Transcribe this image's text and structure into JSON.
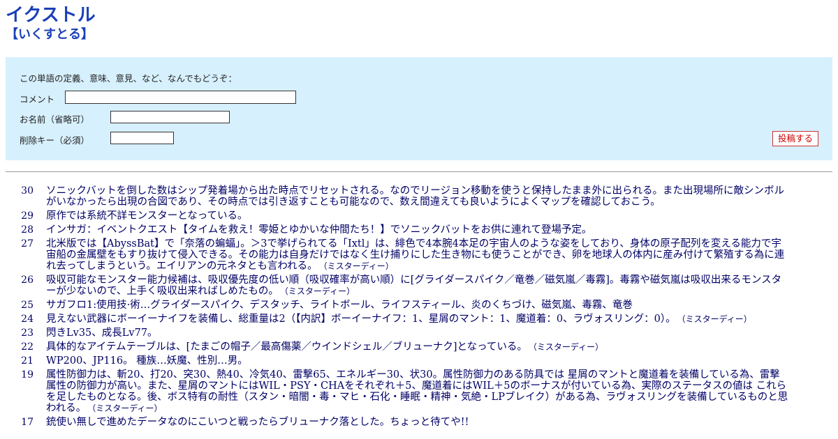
{
  "header": {
    "title": "イクストル",
    "reading": "【いくすとる】"
  },
  "form": {
    "prompt": "この単語の定義、意味、意見、など、なんでもどうぞ：",
    "comment_label": "コメント",
    "name_label": "お名前（省略可）",
    "delete_key_label": "削除キー（必須）",
    "submit_label": "投稿する",
    "comment_value": "",
    "name_value": "",
    "delete_key_value": ""
  },
  "entries": [
    {
      "num": "30",
      "text": "ソニックバットを倒した数はシップ発着場から出た時点でリセットされる。なのでリージョン移動を使うと保持したまま外に出られる。また出現場所に敵シンボルがいなかったら出現の合図であり、その時点では引き返すことも可能なので、数え間違えても良いようによくマップを確認しておこう。",
      "author": ""
    },
    {
      "num": "29",
      "text": "原作では系統不詳モンスターとなっている。",
      "author": ""
    },
    {
      "num": "28",
      "text": "インサガ：イベントクエスト【タイムを救え！零姫とゆかいな仲間たち！】でソニックバットをお供に連れて登場予定。",
      "author": ""
    },
    {
      "num": "27",
      "text": "北米版では【AbyssBat】で「奈落の蝙蝠」。＞3で挙げられてる「Ixtl」は、緋色で4本腕4本足の宇宙人のような姿をしており、身体の原子配列を変える能力で宇宙船の金属壁をもすり抜けて侵入できる。その能力は自身だけではなく生け捕りにした生き物にも使うことができ、卵を地球人の体内に産み付けて繁殖する為に連れ去ってしまうという。エイリアンの元ネタとも言われる。",
      "author": "（ミスターディー）"
    },
    {
      "num": "26",
      "text": "吸収可能なモンスター能力候補は、吸収優先度の低い順（吸収確率が高い順）に[グライダースパイク／竜巻／磁気嵐／毒霧]。毒霧や磁気嵐は吸収出来るモンスターが少ないので、上手く吸収出来ればしめたもの。",
      "author": "（ミスターディー）"
    },
    {
      "num": "25",
      "text": "サガフロ1:使用技·術…グライダースパイク、デスタッチ、ライトボール、ライフスティール、炎のくちづけ、磁気嵐、毒霧、竜巻",
      "author": ""
    },
    {
      "num": "24",
      "text": "見えない武器にボーイーナイフを装備し、総重量は2（【内訳】ボーイーナイフ：1、星屑のマント：1、魔道着：0、ラヴォスリング：0）。",
      "author": "（ミスターディー）"
    },
    {
      "num": "23",
      "text": "閃きLv35、成長Lv77。",
      "author": ""
    },
    {
      "num": "22",
      "text": "具体的なアイテムテーブルは、[たまごの帽子／最高傷薬／ウインドシェル／ブリューナク]となっている。",
      "author": "（ミスターディー）"
    },
    {
      "num": "21",
      "text": "WP200、JP116。 種族…妖魔、性別…男。",
      "author": ""
    },
    {
      "num": "19",
      "text": "属性防御力は、斬20、打20、突30、熱40、冷気40、雷撃65、エネルギー30、状30。属性防御力のある防具では 星屑のマントと魔道着を装備している為、雷撃属性の防御力が高い。また、星屑のマントにはWIL・PSY・CHAをそれぞれ＋5、魔道着にはWIL＋5のボーナスが付いている為、実際のステータスの値は これらを足したものとなる。後、ボス特有の耐性（スタン・暗闇・毒・マヒ・石化・睡眠・精神・気絶・LPブレイク）がある為、ラヴォスリングを装備しているものと思われる。",
      "author": "（ミスターディー）"
    },
    {
      "num": "17",
      "text": "銃使い無しで進めたデータなのにこいつと戦ったらブリューナク落とした。ちょっと待てや!!",
      "author": ""
    }
  ],
  "colors": {
    "title": "#1a3fb8",
    "text": "#000066",
    "form_bg": "#d7f0fd",
    "submit_text": "#cc0000"
  }
}
